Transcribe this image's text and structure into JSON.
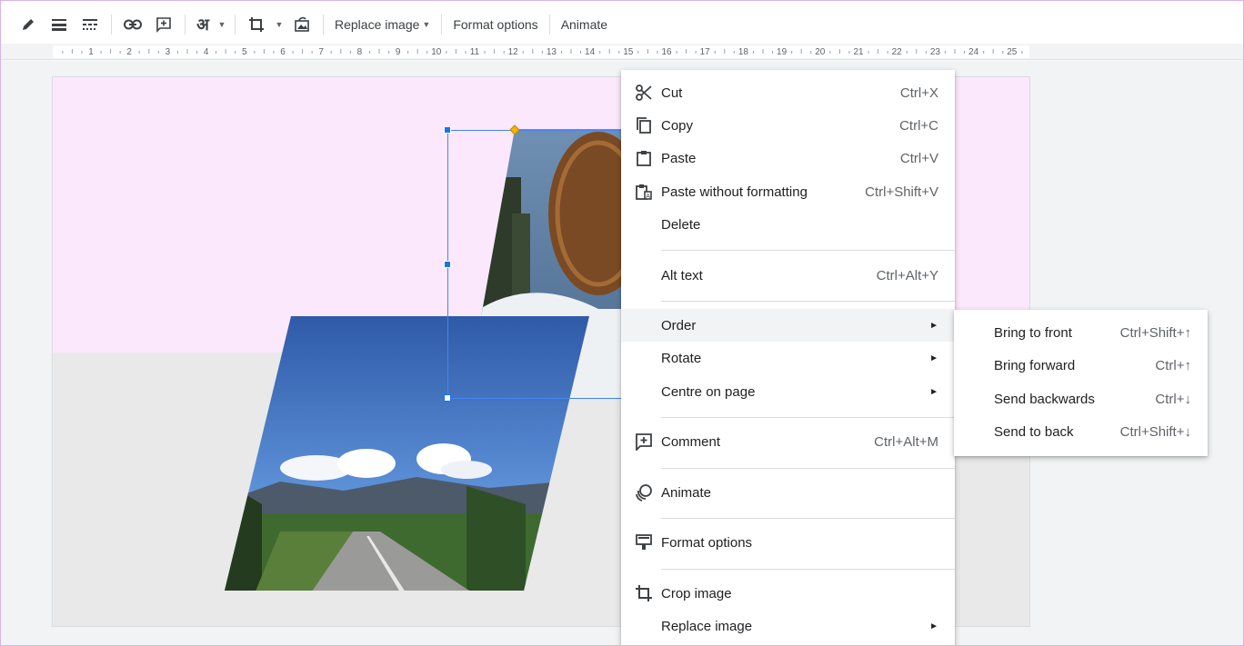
{
  "toolbar": {
    "icons": [
      "pencil-icon",
      "line-weight-icon",
      "line-dash-icon",
      "link-icon",
      "add-comment-icon",
      "input-tools-icon",
      "crop-icon",
      "reset-image-icon"
    ],
    "input_tools_glyph": "अ",
    "replace_image_label": "Replace image",
    "format_options_label": "Format options",
    "animate_label": "Animate"
  },
  "ruler": {
    "numbers": [
      "1",
      "2",
      "3",
      "4",
      "5",
      "6",
      "7",
      "8",
      "9",
      "10",
      "11",
      "12",
      "13",
      "14",
      "15",
      "16",
      "17",
      "18",
      "19",
      "20",
      "21",
      "22",
      "23",
      "24",
      "25"
    ]
  },
  "context_menu": {
    "items": [
      {
        "label": "Cut",
        "shortcut": "Ctrl+X",
        "icon": "scissors-icon"
      },
      {
        "label": "Copy",
        "shortcut": "Ctrl+C",
        "icon": "copy-icon"
      },
      {
        "label": "Paste",
        "shortcut": "Ctrl+V",
        "icon": "clipboard-icon"
      },
      {
        "label": "Paste without formatting",
        "shortcut": "Ctrl+Shift+V",
        "icon": "paste-plain-icon"
      },
      {
        "label": "Delete",
        "shortcut": ""
      },
      {
        "label": "Alt text",
        "shortcut": "Ctrl+Alt+Y"
      },
      {
        "label": "Order",
        "submenu": true
      },
      {
        "label": "Rotate",
        "submenu": true
      },
      {
        "label": "Centre on page",
        "submenu": true
      },
      {
        "label": "Comment",
        "shortcut": "Ctrl+Alt+M",
        "icon": "comment-icon"
      },
      {
        "label": "Animate",
        "icon": "animate-icon"
      },
      {
        "label": "Format options",
        "icon": "format-options-icon"
      },
      {
        "label": "Crop image",
        "icon": "crop-icon"
      },
      {
        "label": "Replace image",
        "submenu": true
      }
    ]
  },
  "order_submenu": {
    "items": [
      {
        "label": "Bring to front",
        "shortcut": "Ctrl+Shift+↑"
      },
      {
        "label": "Bring forward",
        "shortcut": "Ctrl+↑"
      },
      {
        "label": "Send backwards",
        "shortcut": "Ctrl+↓"
      },
      {
        "label": "Send to back",
        "shortcut": "Ctrl+Shift+↓"
      }
    ]
  },
  "colors": {
    "accent": "#1a73e8",
    "annotation_arrow": "#b57ce8",
    "slide_top": "#fce8fc"
  }
}
